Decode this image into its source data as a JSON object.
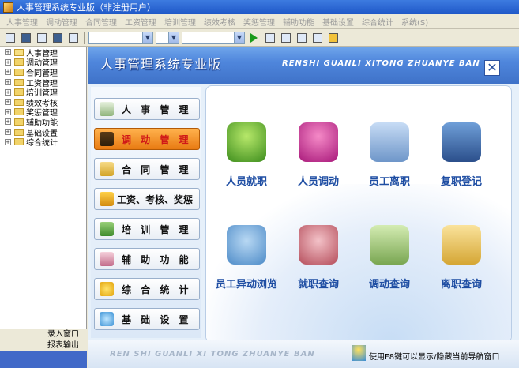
{
  "window": {
    "title": "人事管理系统专业版（非注册用户）"
  },
  "menu": [
    "人事管理",
    "调动管理",
    "合同管理",
    "工资管理",
    "培训管理",
    "绩效考核",
    "奖惩管理",
    "辅助功能",
    "基础设置",
    "综合统计",
    "系统(S)"
  ],
  "tree": {
    "items": [
      "人事管理",
      "调动管理",
      "合同管理",
      "工资管理",
      "培训管理",
      "绩效考核",
      "奖惩管理",
      "辅助功能",
      "基础设置",
      "综合统计"
    ]
  },
  "left_footer": {
    "entry_window": "录入窗口",
    "report_output": "报表输出"
  },
  "banner": {
    "cn_title": "人事管理系统专业版",
    "en_title": "RENSHI GUANLI XITONG ZHUANYE BAN"
  },
  "nav": [
    {
      "label": "人 事 管 理"
    },
    {
      "label": "调 动 管 理"
    },
    {
      "label": "合 同 管 理"
    },
    {
      "label": "工资、考核、奖惩"
    },
    {
      "label": "培 训 管 理"
    },
    {
      "label": "辅 助 功 能"
    },
    {
      "label": "综 合 统 计"
    },
    {
      "label": "基 础 设 置"
    }
  ],
  "active_nav": "调 动 管 理",
  "tiles": [
    "人员就职",
    "人员调动",
    "员工离职",
    "复职登记",
    "员工异动浏览",
    "就职查询",
    "调动查询",
    "离职查询"
  ],
  "status": {
    "en_sub": "REN SHI GUANLI XI TONG ZHUANYE BAN",
    "hint": "使用F8键可以显示/隐藏当前导航窗口"
  },
  "colors": {
    "accent": "#3f72c8",
    "active": "#e87a12",
    "tile_text": "#1f4ea3"
  }
}
